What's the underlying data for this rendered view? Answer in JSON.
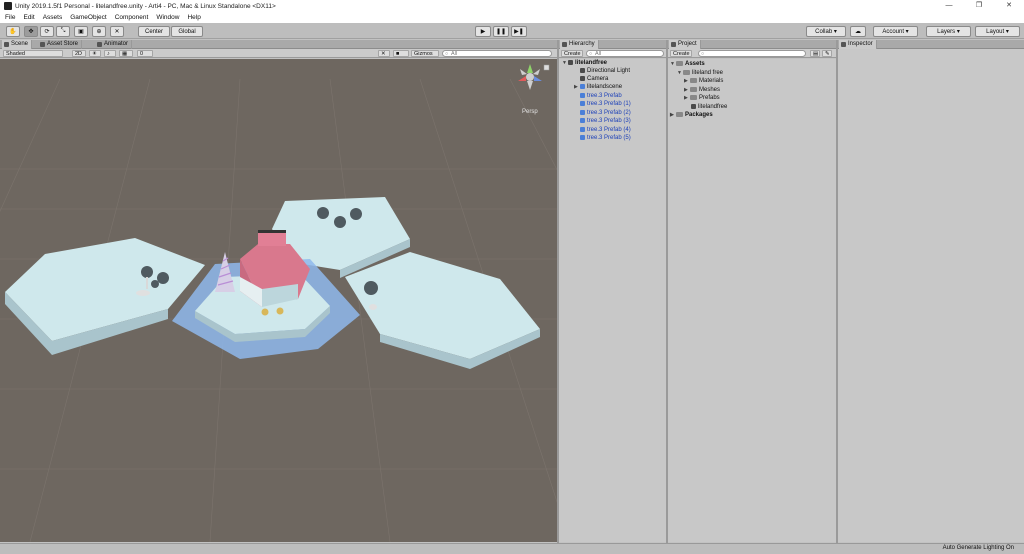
{
  "window": {
    "title": "Unity 2019.1.5f1 Personal - litelandfree.unity - Arti4 - PC, Mac & Linux Standalone <DX11>",
    "minimize": "—",
    "maximize": "❐",
    "close": "✕"
  },
  "menu": [
    "File",
    "Edit",
    "Assets",
    "GameObject",
    "Component",
    "Window",
    "Help"
  ],
  "toolbar": {
    "pivot": "Center",
    "space": "Global",
    "collab": "Collab ▾",
    "account": "Account ▾",
    "layers": "Layers ▾",
    "layout": "Layout ▾"
  },
  "scene": {
    "tabs": [
      "Scene",
      "Asset Store",
      "Animator"
    ],
    "shading": "Shaded",
    "mode2d": "2D",
    "gizmos": "Gizmos ▾",
    "search_placeholder": "All",
    "persp": "Persp",
    "layers_count": "0"
  },
  "hierarchy": {
    "tab": "Hierarchy",
    "create": "Create ▾",
    "search_placeholder": "All",
    "scene_name": "litelandfree",
    "items": [
      {
        "label": "Directional Light",
        "type": "object"
      },
      {
        "label": "Camera",
        "type": "object"
      },
      {
        "label": "litelandscene",
        "type": "object"
      },
      {
        "label": "tree.3 Prefab",
        "type": "prefab"
      },
      {
        "label": "tree.3 Prefab (1)",
        "type": "prefab"
      },
      {
        "label": "tree.3 Prefab (2)",
        "type": "prefab"
      },
      {
        "label": "tree.3 Prefab (3)",
        "type": "prefab"
      },
      {
        "label": "tree.3 Prefab (4)",
        "type": "prefab"
      },
      {
        "label": "tree.3 Prefab (5)",
        "type": "prefab"
      }
    ]
  },
  "project": {
    "tab": "Project",
    "create": "Create ▾",
    "assets": "Assets",
    "folder": "liteland free",
    "subfolders": [
      "Materials",
      "Meshes",
      "Prefabs"
    ],
    "scene_file": "litelandfree",
    "packages": "Packages"
  },
  "inspector": {
    "tab": "Inspector"
  },
  "status": {
    "text": "Auto Generate Lighting On"
  },
  "colors": {
    "scene_bg": "#6e6760",
    "hex_top": "#cfe8ec",
    "hex_side": "#a9c4cc",
    "selection_blue": "#8fb8ec",
    "roof_pink": "#d9788d",
    "prefab_text": "#1b3fb8"
  }
}
